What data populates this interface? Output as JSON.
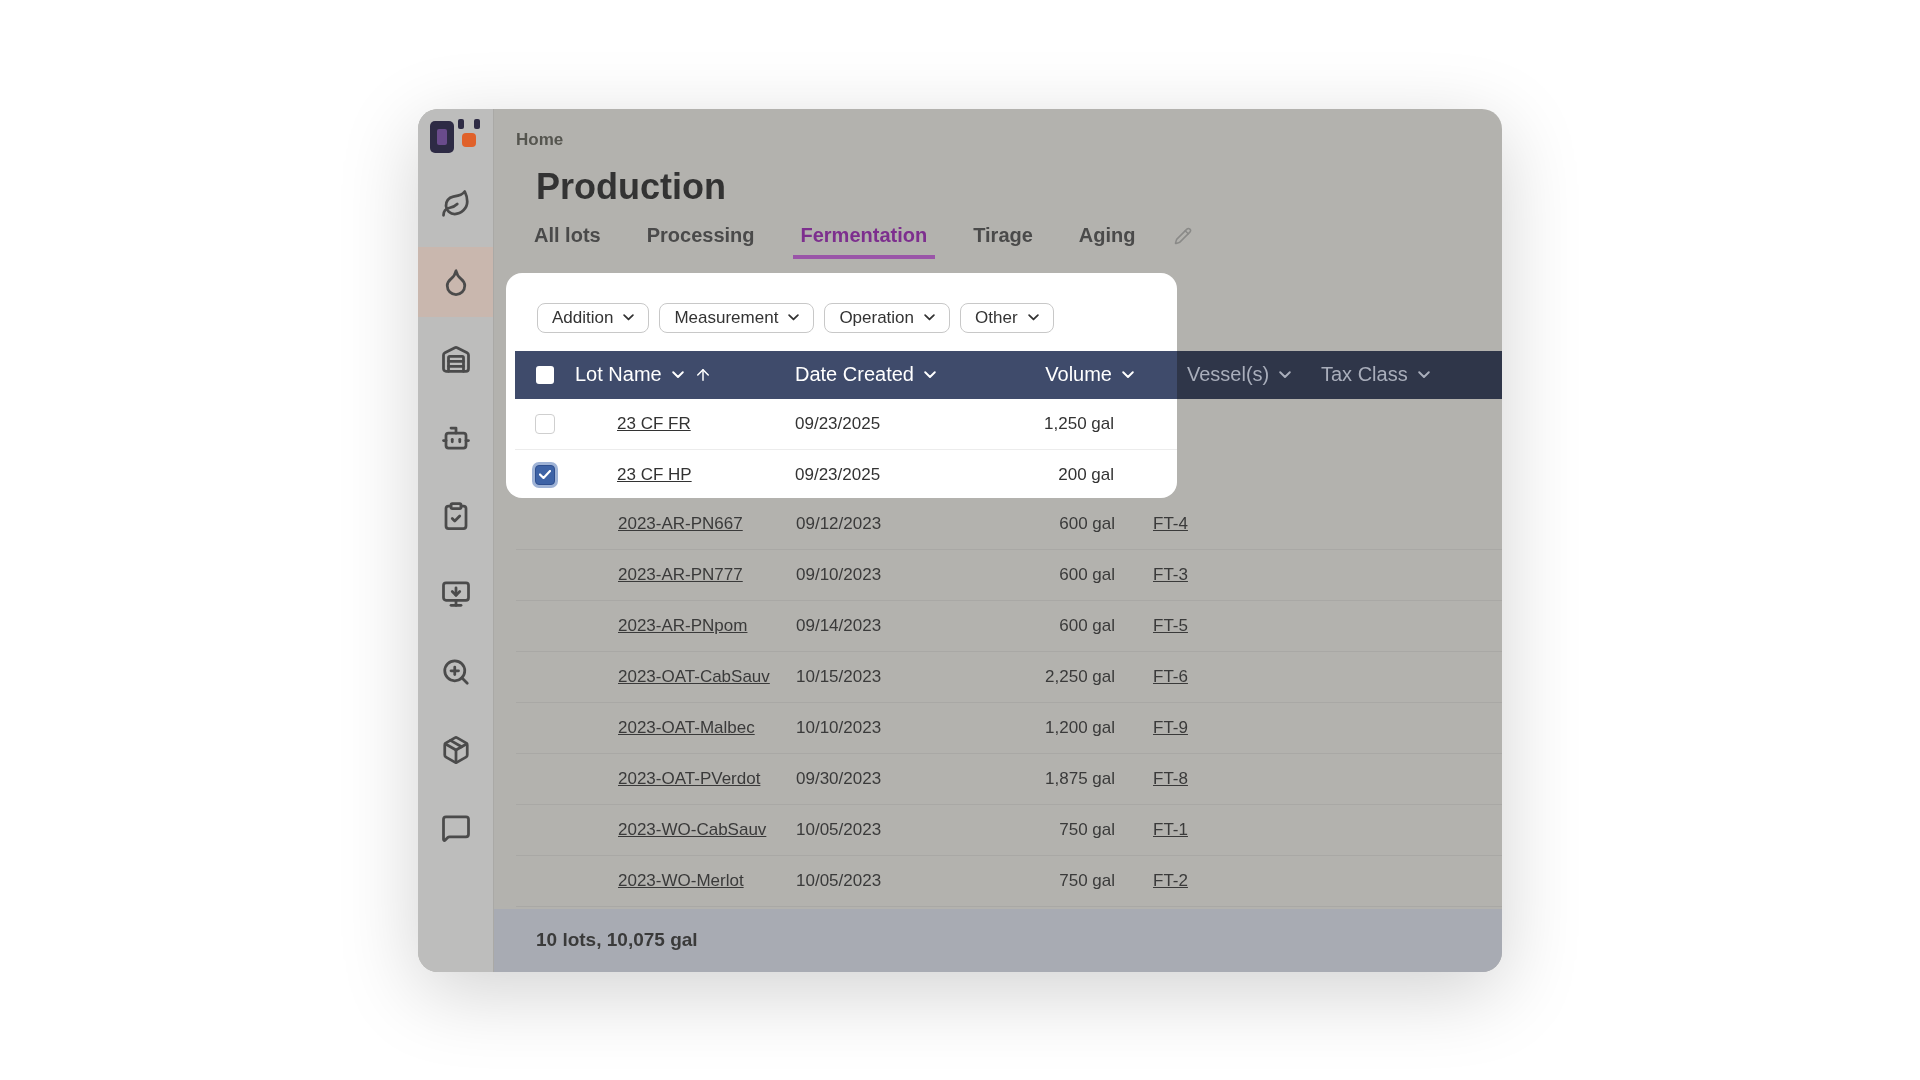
{
  "sidebar": {
    "items": [
      {
        "selected": false
      },
      {
        "selected": true
      },
      {
        "selected": false
      },
      {
        "selected": false
      },
      {
        "selected": false
      },
      {
        "selected": false
      },
      {
        "selected": false
      },
      {
        "selected": false
      },
      {
        "selected": false
      }
    ]
  },
  "breadcrumb": [
    "Home"
  ],
  "title": "Production",
  "tabs": [
    {
      "label": "All lots",
      "selected": false
    },
    {
      "label": "Processing",
      "selected": false
    },
    {
      "label": "Fermentation",
      "selected": true
    },
    {
      "label": "Tirage",
      "selected": false
    },
    {
      "label": "Aging",
      "selected": false
    }
  ],
  "filters": [
    "Addition",
    "Measurement",
    "Operation",
    "Other"
  ],
  "table": {
    "select_all_checked": false,
    "columns": [
      {
        "label": "Lot Name",
        "highlighted": true,
        "sorted": true
      },
      {
        "label": "Date Created",
        "highlighted": true,
        "sorted": false
      },
      {
        "label": "Volume",
        "highlighted": true,
        "sorted": false
      },
      {
        "label": "Vessel(s)",
        "highlighted": false,
        "sorted": false
      },
      {
        "label": "Tax Class",
        "highlighted": false,
        "sorted": false
      }
    ],
    "highlighted_rows": [
      {
        "lot": "23 CF FR",
        "date": "09/23/2025",
        "volume": "1,250 gal",
        "checked": false
      },
      {
        "lot": "23 CF HP",
        "date": "09/23/2025",
        "volume": "200 gal",
        "checked": true
      }
    ],
    "rows": [
      {
        "lot": "2023-AR-PN667",
        "date": "09/12/2023",
        "volume": "600 gal",
        "vessel": "FT-4"
      },
      {
        "lot": "2023-AR-PN777",
        "date": "09/10/2023",
        "volume": "600 gal",
        "vessel": "FT-3"
      },
      {
        "lot": "2023-AR-PNpom",
        "date": "09/14/2023",
        "volume": "600 gal",
        "vessel": "FT-5"
      },
      {
        "lot": "2023-OAT-CabSauv",
        "date": "10/15/2023",
        "volume": "2,250 gal",
        "vessel": "FT-6"
      },
      {
        "lot": "2023-OAT-Malbec",
        "date": "10/10/2023",
        "volume": "1,200 gal",
        "vessel": "FT-9"
      },
      {
        "lot": "2023-OAT-PVerdot",
        "date": "09/30/2023",
        "volume": "1,875 gal",
        "vessel": "FT-8"
      },
      {
        "lot": "2023-WO-CabSauv",
        "date": "10/05/2023",
        "volume": "750 gal",
        "vessel": "FT-1"
      },
      {
        "lot": "2023-WO-Merlot",
        "date": "10/05/2023",
        "volume": "750 gal",
        "vessel": "FT-2"
      }
    ],
    "footer": "10 lots, 10,075 gal"
  }
}
